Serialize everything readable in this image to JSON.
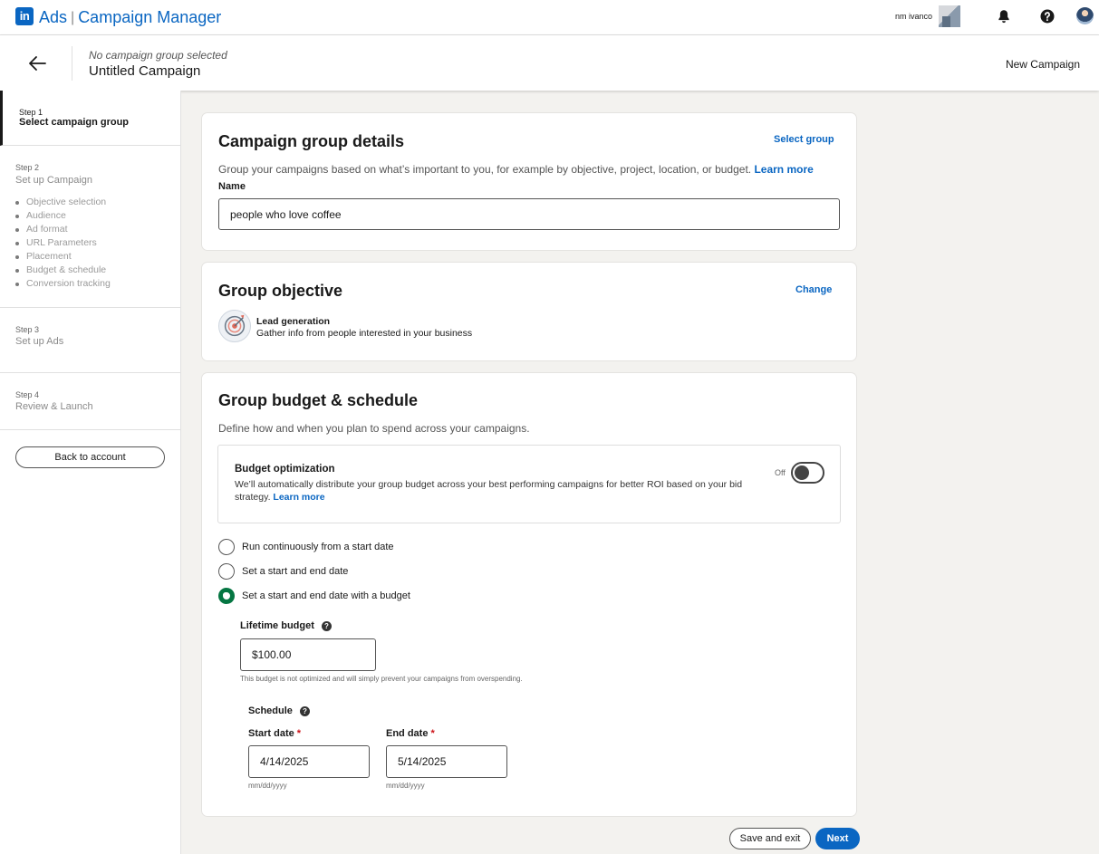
{
  "app": {
    "logo_text": "in",
    "product": "Ads",
    "separator": "|",
    "title": "Campaign Manager",
    "user_name": "nm ivanco",
    "icons": [
      "bell-icon",
      "help-icon",
      "avatar"
    ]
  },
  "header": {
    "subtitle": "No campaign group selected",
    "title": "Untitled Campaign",
    "right_label": "New Campaign"
  },
  "sidebar": {
    "steps": [
      {
        "num": "Step 1",
        "title": "Select campaign group",
        "active": true
      },
      {
        "num": "Step 2",
        "title": "Set up Campaign",
        "items": [
          "Objective selection",
          "Audience",
          "Ad format",
          "URL Parameters",
          "Placement",
          "Budget & schedule",
          "Conversion tracking"
        ]
      },
      {
        "num": "Step 3",
        "title": "Set up Ads"
      },
      {
        "num": "Step 4",
        "title": "Review & Launch"
      }
    ],
    "back_button": "Back to account"
  },
  "group_details": {
    "title": "Campaign group details",
    "link": "Select group",
    "description": "Group your campaigns based on what’s important to you, for example by objective, project, location, or budget.",
    "learn_more": "Learn more",
    "name_label": "Name",
    "name_value": "people who love coffee"
  },
  "objective": {
    "title": "Group objective",
    "link": "Change",
    "name": "Lead generation",
    "description": "Gather info from people interested in your business"
  },
  "budget": {
    "title": "Group budget & schedule",
    "description": "Define how and when you plan to spend across your campaigns.",
    "optimization": {
      "title": "Budget optimization",
      "description": "We’ll automatically distribute your group budget across your best performing campaigns for better ROI based on your bid strategy.",
      "learn_more": "Learn more",
      "toggle_label": "Off",
      "enabled": false
    },
    "radio_options": [
      {
        "label": "Run continuously from a start date",
        "checked": false
      },
      {
        "label": "Set a start and end date",
        "checked": false
      },
      {
        "label": "Set a start and end date with a budget",
        "checked": true
      }
    ],
    "lifetime_label": "Lifetime budget",
    "lifetime_value": "$100.00",
    "lifetime_note": "This budget is not optimized and will simply prevent your campaigns from overspending.",
    "schedule_label": "Schedule",
    "start_label": "Start date",
    "end_label": "End date",
    "required_mark": "*",
    "start_value": "4/14/2025",
    "end_value": "5/14/2025",
    "date_format": "mm/dd/yyyy"
  },
  "footer": {
    "save_exit": "Save and exit",
    "next": "Next"
  },
  "colors": {
    "brand": "#0a66c2",
    "radio_checked": "#057642",
    "required": "#cc1016",
    "background": "#f3f2ef"
  }
}
